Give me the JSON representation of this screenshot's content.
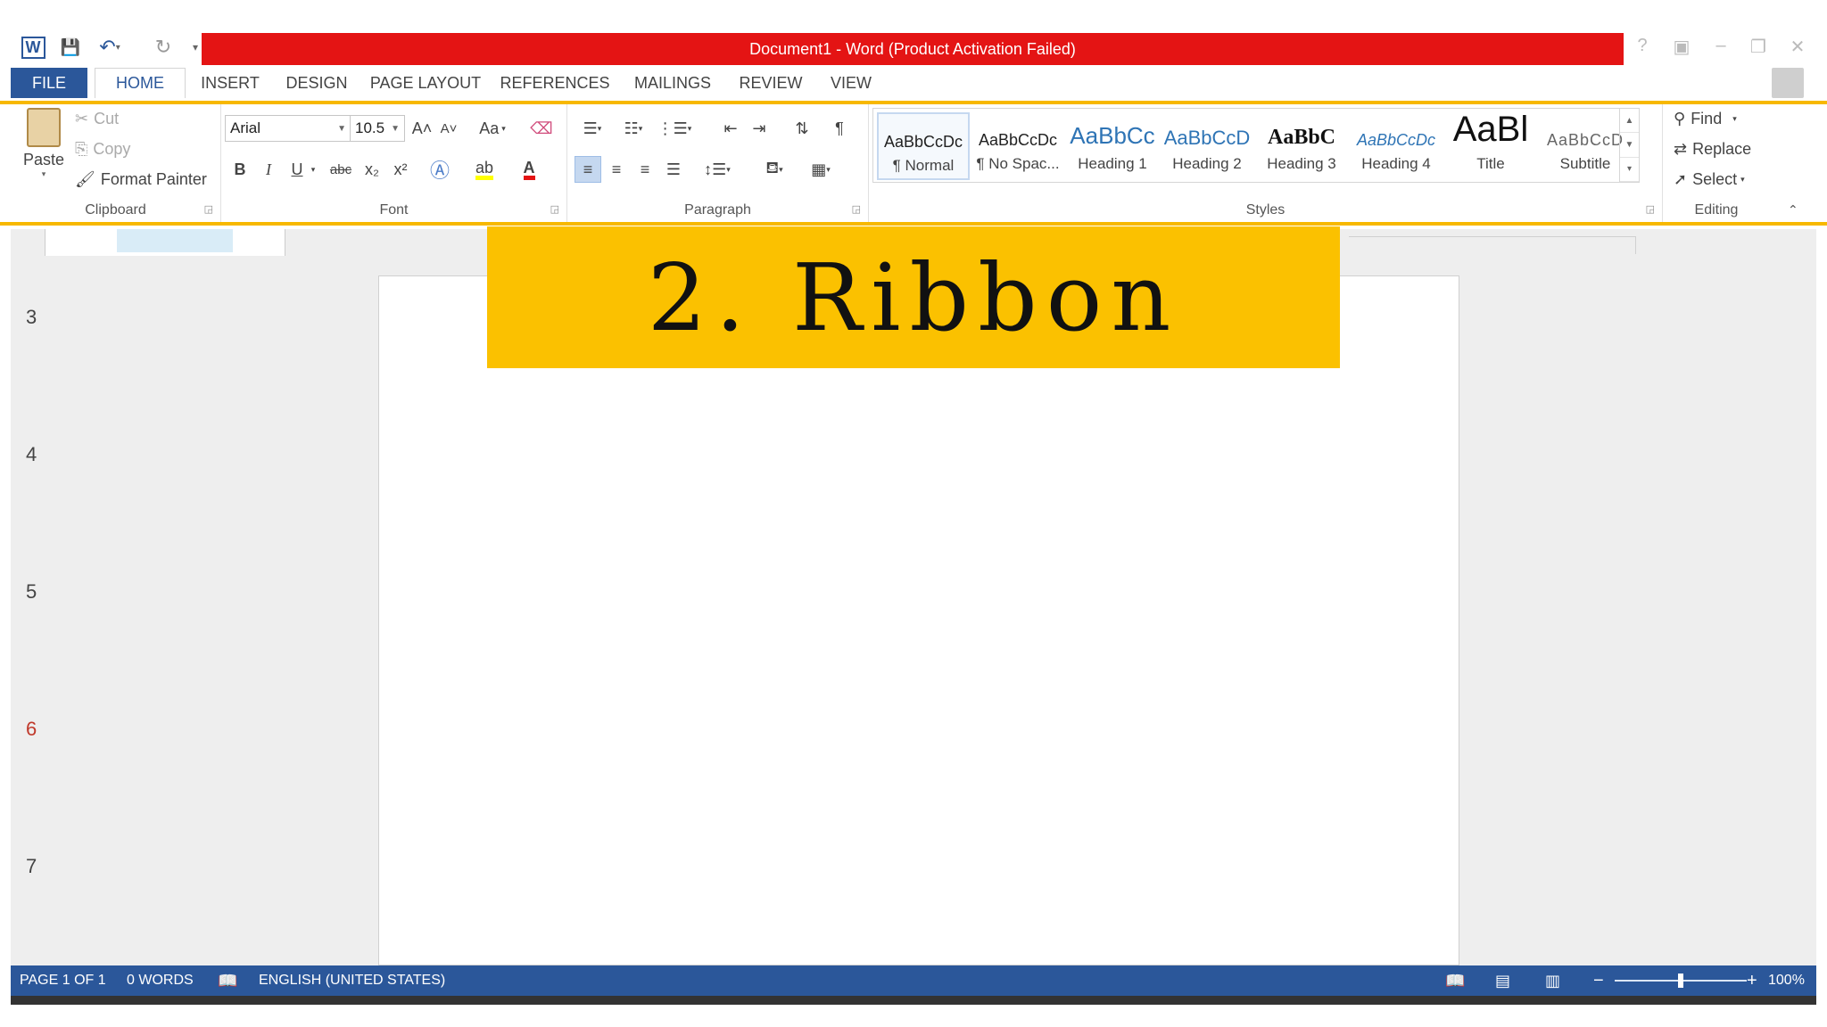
{
  "window": {
    "title": "Document1 -  Word (Product Activation Failed)",
    "accent": "#2b579a",
    "title_bar_color": "#e41414",
    "controls": [
      "?",
      "▣",
      "–",
      "❐",
      "✕"
    ]
  },
  "qat": {
    "word_icon": "W",
    "save_icon": "💾",
    "undo_icon": "↶",
    "redo_icon": "↻",
    "customize_icon": "▾"
  },
  "tabs": [
    "FILE",
    "HOME",
    "INSERT",
    "DESIGN",
    "PAGE LAYOUT",
    "REFERENCES",
    "MAILINGS",
    "REVIEW",
    "VIEW"
  ],
  "ribbon": {
    "clipboard": {
      "label": "Clipboard",
      "paste": "Paste",
      "cut": "Cut",
      "copy": "Copy",
      "format_painter": "Format Painter"
    },
    "font": {
      "label": "Font",
      "font_name": "Arial",
      "font_size": "10.5",
      "grow": "A˄",
      "shrink": "A˅",
      "change_case": "Aa",
      "bold": "B",
      "italic": "I",
      "underline": "U",
      "strike": "abc",
      "subscript": "x₂",
      "superscript": "x²"
    },
    "paragraph": {
      "label": "Paragraph",
      "pilcrow": "¶"
    },
    "styles": {
      "label": "Styles",
      "items": [
        {
          "preview": "AaBbCcDc",
          "name": "¶ Normal"
        },
        {
          "preview": "AaBbCcDc",
          "name": "¶ No Spac..."
        },
        {
          "preview": "AaBbCc",
          "name": "Heading 1"
        },
        {
          "preview": "AaBbCcD",
          "name": "Heading 2"
        },
        {
          "preview": "AaBbC",
          "name": "Heading 3"
        },
        {
          "preview": "AaBbCcDc",
          "name": "Heading 4"
        },
        {
          "preview": "AaBl",
          "name": "Title"
        },
        {
          "preview": "AaBbCcD",
          "name": "Subtitle"
        }
      ]
    },
    "editing": {
      "label": "Editing",
      "find": "Find",
      "replace": "Replace",
      "select": "Select"
    }
  },
  "document": {
    "page_numbers": [
      "3",
      "4",
      "5",
      "6",
      "7"
    ]
  },
  "overlay": {
    "text": "2. Ribbon",
    "color": "#fbc100"
  },
  "statusbar": {
    "page": "PAGE 1 OF 1",
    "words": "0 WORDS",
    "language": "ENGLISH (UNITED STATES)",
    "zoom": "100%",
    "zoom_level": 0.5
  }
}
